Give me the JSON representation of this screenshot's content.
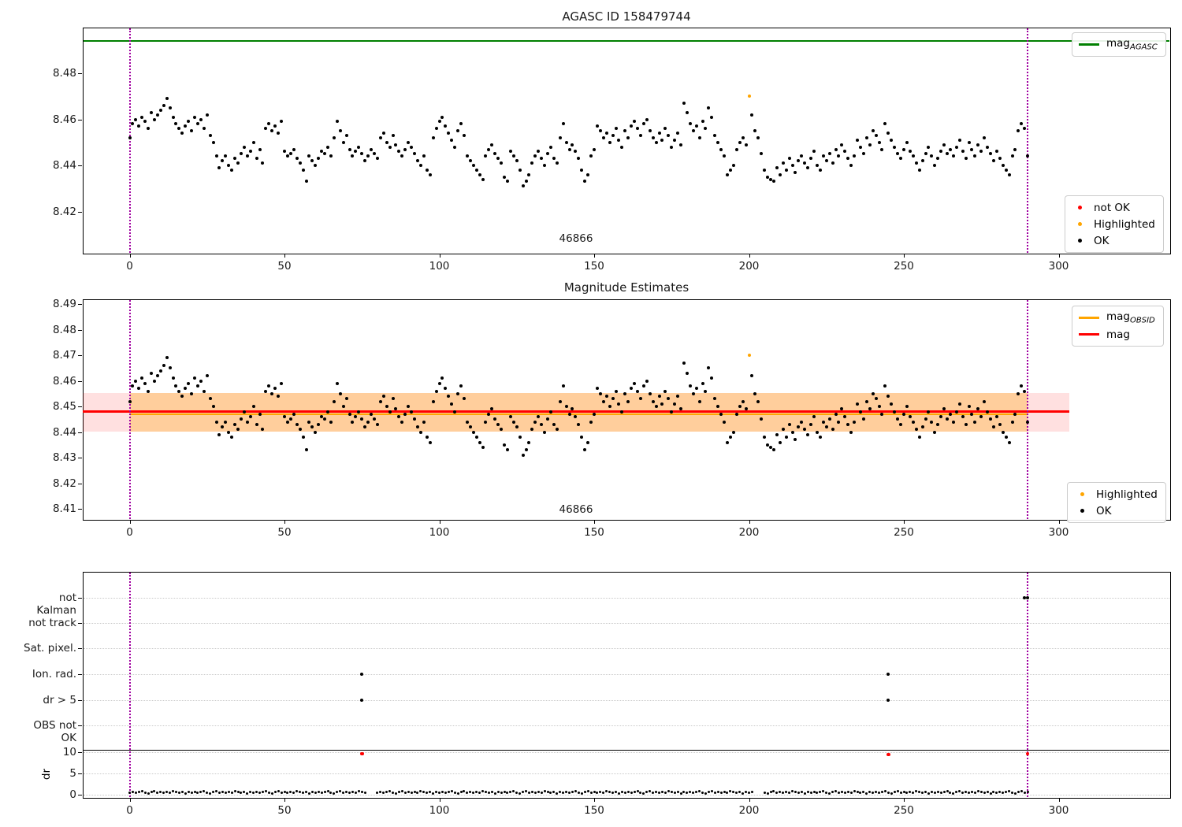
{
  "figure_bg": "#ffffff",
  "colors": {
    "mag_agasc_line": "#008000",
    "mag_line": "#ff0000",
    "mag_obsid_line": "#ffa500",
    "highlighted": "#ffa500",
    "not_ok": "#ff0000",
    "ok": "#000000",
    "obsid_vline": "#a000a0",
    "band_pink": "rgba(255,0,0,0.12)",
    "band_orange": "rgba(255,165,0,0.30)",
    "grid": "#c9c9c9",
    "threshold_line": "#000000"
  },
  "top_plot": {
    "title": "AGASC ID 158479744",
    "obsid_label": "46866",
    "yticks": [
      "8.48",
      "8.46",
      "8.44",
      "8.42"
    ],
    "xticks": [
      "0",
      "50",
      "100",
      "150",
      "200",
      "250",
      "300"
    ],
    "legend_line": {
      "label_main": "mag",
      "label_sub": "AGASC"
    },
    "legend_points": [
      {
        "label": "not OK",
        "color": "#ff0000"
      },
      {
        "label": "Highlighted",
        "color": "#ffa500"
      },
      {
        "label": "OK",
        "color": "#000000"
      }
    ]
  },
  "middle_plot": {
    "title": "Magnitude Estimates",
    "obsid_label": "46866",
    "yticks": [
      "8.49",
      "8.48",
      "8.47",
      "8.46",
      "8.45",
      "8.44",
      "8.43",
      "8.42",
      "8.41"
    ],
    "xticks": [
      "0",
      "50",
      "100",
      "150",
      "200",
      "250",
      "300"
    ],
    "legend_lines": [
      {
        "label_main": "mag",
        "label_sub": "OBSID",
        "color": "#ffa500"
      },
      {
        "label_main": "mag",
        "label_sub": "",
        "color": "#ff0000"
      }
    ],
    "legend_points": [
      {
        "label": "Highlighted",
        "color": "#ffa500"
      },
      {
        "label": "OK",
        "color": "#000000"
      }
    ]
  },
  "bottom_plot": {
    "flag_labels": [
      "not Kalman",
      "not track",
      "Sat. pixel.",
      "Ion. rad.",
      "dr > 5",
      "OBS not OK"
    ],
    "dr_ticks": [
      "10",
      "5",
      "0"
    ],
    "dr_axis_label": "dr",
    "xticks": [
      "0",
      "50",
      "100",
      "150",
      "200",
      "250",
      "300"
    ]
  },
  "chart_data": [
    {
      "type": "scatter",
      "title": "AGASC ID 158479744",
      "ylabel": "",
      "ylim": [
        8.402,
        8.5
      ],
      "xlim": [
        -15,
        335
      ],
      "yticks": [
        8.48,
        8.46,
        8.44,
        8.42
      ],
      "xticks": [
        0,
        50,
        100,
        150,
        200,
        250,
        300
      ],
      "mag_agasc_value": 8.494,
      "obsid_vlines_x": [
        0,
        290
      ],
      "obsid_id": "46866",
      "obsid_label_x": 144,
      "x_start": 0,
      "x_step": 1,
      "y_base": 8.4,
      "y_milli_offsets": [
        52,
        58,
        60,
        57,
        61,
        59,
        56,
        63,
        60,
        62,
        64,
        66,
        69,
        65,
        61,
        58,
        56,
        54,
        57,
        59,
        55,
        61,
        58,
        60,
        56,
        62,
        53,
        50,
        44,
        39,
        42,
        44,
        40,
        38,
        43,
        41,
        45,
        48,
        44,
        46,
        50,
        43,
        47,
        41,
        56,
        58,
        55,
        57,
        54,
        59,
        46,
        44,
        45,
        47,
        43,
        41,
        38,
        33,
        44,
        42,
        40,
        43,
        46,
        45,
        48,
        44,
        52,
        59,
        55,
        50,
        53,
        47,
        44,
        46,
        48,
        45,
        42,
        44,
        47,
        45,
        43,
        52,
        54,
        50,
        48,
        53,
        49,
        46,
        44,
        47,
        50,
        48,
        45,
        42,
        40,
        44,
        38,
        36,
        52,
        56,
        59,
        61,
        57,
        54,
        51,
        48,
        55,
        58,
        53,
        44,
        42,
        40,
        38,
        36,
        34,
        44,
        47,
        49,
        45,
        43,
        41,
        35,
        33,
        46,
        44,
        42,
        38,
        31,
        33,
        36,
        41,
        44,
        46,
        43,
        40,
        45,
        48,
        43,
        41,
        52,
        58,
        50,
        47,
        49,
        46,
        43,
        38,
        33,
        36,
        44,
        47,
        57,
        55,
        52,
        54,
        50,
        53,
        56,
        51,
        48,
        55,
        52,
        57,
        59,
        56,
        53,
        58,
        60,
        55,
        52,
        50,
        54,
        51,
        56,
        53,
        48,
        51,
        54,
        49,
        67,
        63,
        58,
        55,
        57,
        52,
        59,
        56,
        65,
        61,
        53,
        50,
        47,
        44,
        36,
        38,
        40,
        47,
        50,
        52,
        49,
        70,
        62,
        55,
        52,
        45,
        38,
        35,
        34,
        33,
        39,
        36,
        41,
        38,
        43,
        40,
        37,
        42,
        44,
        41,
        39,
        43,
        46,
        40,
        38,
        44,
        42,
        45,
        41,
        47,
        44,
        49,
        46,
        43,
        40,
        44,
        51,
        48,
        45,
        52,
        49,
        55,
        53,
        50,
        47,
        58,
        54,
        51,
        48,
        45,
        43,
        47,
        50,
        46,
        44,
        41,
        38,
        42,
        45,
        48,
        44,
        40,
        43,
        46,
        49,
        45,
        47,
        44,
        48,
        51,
        46,
        43,
        50,
        47,
        44,
        49,
        46,
        52,
        48,
        45,
        42,
        46,
        43,
        40,
        38,
        36,
        44,
        47,
        55,
        58,
        56,
        44
      ],
      "highlighted_point": {
        "index": 200,
        "x": 200,
        "value": 8.47
      }
    },
    {
      "type": "scatter",
      "title": "Magnitude Estimates",
      "ylim": [
        8.405,
        8.491
      ],
      "xlim": [
        -15,
        335
      ],
      "yticks": [
        8.49,
        8.48,
        8.47,
        8.46,
        8.45,
        8.44,
        8.43,
        8.42,
        8.41
      ],
      "xticks": [
        0,
        50,
        100,
        150,
        200,
        250,
        300
      ],
      "mag_value": 8.448,
      "mag_obsid_value": 8.4475,
      "band_range": [
        8.44,
        8.4553
      ],
      "band_x_range": [
        -15,
        303.5
      ],
      "obsid_x_range": [
        0,
        290
      ],
      "obsid_vlines_x": [
        0,
        290
      ],
      "obsid_id": "46866",
      "obsid_label_x": 144,
      "points_ref": 0,
      "highlighted_point": {
        "index": 200,
        "x": 200,
        "value": 8.47
      }
    },
    {
      "type": "scatter",
      "ylabel": "dr",
      "xlim": [
        -15,
        335
      ],
      "xticks": [
        0,
        50,
        100,
        150,
        200,
        250,
        300
      ],
      "flag_rows": [
        "not Kalman",
        "not track",
        "Sat. pixel.",
        "Ion. rad.",
        "dr > 5",
        "OBS not OK"
      ],
      "dr_ticks": [
        10,
        5,
        0
      ],
      "dr_threshold": 10,
      "obsid_vlines_x": [
        0,
        290
      ],
      "flag_points": [
        {
          "row": "Ion. rad.",
          "x": [
            75,
            245
          ]
        },
        {
          "row": "dr > 5",
          "x": [
            75,
            245
          ]
        },
        {
          "row": "not Kalman",
          "x": [
            289,
            290
          ]
        }
      ],
      "dr_not_ok_points": [
        {
          "x": 75,
          "dr": 9.6
        },
        {
          "x": 245,
          "dr": 9.4
        },
        {
          "x": 290,
          "dr": 9.6
        }
      ],
      "dr_ok_cycle_tenths": [
        5,
        7,
        4,
        6,
        8,
        5,
        3,
        6,
        9,
        4,
        7,
        5,
        6,
        4,
        8,
        6,
        5,
        7,
        3,
        6
      ],
      "dr_ok_n_points": 291,
      "dr_ok_skip_x": [
        77,
        78,
        79,
        202,
        203,
        204
      ]
    }
  ]
}
